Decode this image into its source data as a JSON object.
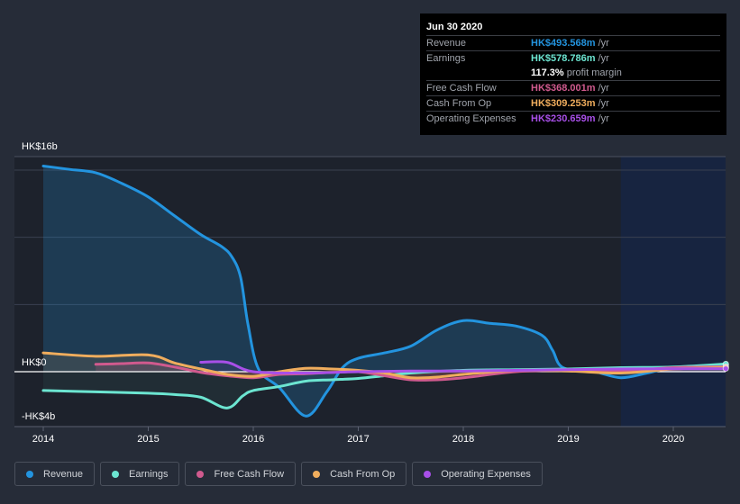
{
  "tooltip": {
    "date": "Jun 30 2020",
    "rows": [
      {
        "label": "Revenue",
        "value": "HK$493.568m",
        "unit": "/yr",
        "color": "#2394df"
      },
      {
        "label": "Earnings",
        "value": "HK$578.786m",
        "unit": "/yr",
        "color": "#6ce5d1"
      },
      {
        "label": "",
        "value": "117.3%",
        "unit": "profit margin",
        "color": "#ffffff"
      },
      {
        "label": "Free Cash Flow",
        "value": "HK$368.001m",
        "unit": "/yr",
        "color": "#d05a8e"
      },
      {
        "label": "Cash From Op",
        "value": "HK$309.253m",
        "unit": "/yr",
        "color": "#f0ad5d"
      },
      {
        "label": "Operating Expenses",
        "value": "HK$230.659m",
        "unit": "/yr",
        "color": "#a84fe8"
      }
    ]
  },
  "legend": [
    {
      "label": "Revenue",
      "color": "#2394df"
    },
    {
      "label": "Earnings",
      "color": "#6ce5d1"
    },
    {
      "label": "Free Cash Flow",
      "color": "#d05a8e"
    },
    {
      "label": "Cash From Op",
      "color": "#f0ad5d"
    },
    {
      "label": "Operating Expenses",
      "color": "#a84fe8"
    }
  ],
  "chart_data": {
    "type": "area",
    "title": "",
    "xlabel": "",
    "ylabel": "",
    "y_unit": "HK$ billions",
    "y_tick_labels": [
      {
        "value": 16,
        "label": "HK$16b"
      },
      {
        "value": 0,
        "label": "HK$0"
      },
      {
        "value": -4,
        "label": "-HK$4b"
      }
    ],
    "ylim": [
      -4,
      16
    ],
    "xlim": [
      2013.73,
      2020.5
    ],
    "x_ticks": [
      2014,
      2015,
      2016,
      2017,
      2018,
      2019,
      2020
    ],
    "x_tick_labels": [
      "2014",
      "2015",
      "2016",
      "2017",
      "2018",
      "2019",
      "2020"
    ],
    "grid": true,
    "highlight_range": [
      2019.5,
      2020.5
    ],
    "series": [
      {
        "name": "Revenue",
        "color": "#2394df",
        "x": [
          2014.0,
          2014.25,
          2014.5,
          2014.75,
          2015.0,
          2015.25,
          2015.5,
          2015.7,
          2015.8,
          2015.88,
          2015.95,
          2016.05,
          2016.25,
          2016.5,
          2016.7,
          2016.85,
          2017.0,
          2017.25,
          2017.5,
          2017.75,
          2018.0,
          2018.25,
          2018.5,
          2018.75,
          2018.85,
          2018.95,
          2019.25,
          2019.5,
          2019.75,
          2020.0,
          2020.5
        ],
        "values": [
          15.3,
          15.05,
          14.8,
          14.0,
          13.0,
          11.6,
          10.2,
          9.3,
          8.5,
          7.0,
          3.5,
          0.2,
          -1.2,
          -3.3,
          -1.5,
          0.3,
          1.0,
          1.4,
          1.9,
          3.1,
          3.8,
          3.6,
          3.4,
          2.7,
          1.6,
          0.3,
          0.0,
          -0.45,
          -0.1,
          0.3,
          0.49
        ]
      },
      {
        "name": "Earnings",
        "color": "#6ce5d1",
        "x": [
          2014.0,
          2014.5,
          2015.0,
          2015.25,
          2015.5,
          2015.75,
          2015.9,
          2016.0,
          2016.25,
          2016.5,
          2016.75,
          2017.0,
          2017.25,
          2017.5,
          2018.0,
          2018.5,
          2019.0,
          2019.5,
          2020.0,
          2020.5
        ],
        "values": [
          -1.4,
          -1.5,
          -1.6,
          -1.7,
          -1.9,
          -2.7,
          -1.8,
          -1.4,
          -1.1,
          -0.7,
          -0.6,
          -0.5,
          -0.3,
          -0.1,
          0.1,
          0.15,
          0.2,
          0.3,
          0.35,
          0.58
        ]
      },
      {
        "name": "Free Cash Flow",
        "color": "#d05a8e",
        "x": [
          2014.5,
          2014.75,
          2015.0,
          2015.25,
          2015.5,
          2015.75,
          2016.0,
          2016.25,
          2016.5,
          2016.75,
          2017.0,
          2017.25,
          2017.5,
          2017.75,
          2018.0,
          2018.5,
          2019.0,
          2019.5,
          2020.0,
          2020.5
        ],
        "values": [
          0.55,
          0.6,
          0.65,
          0.35,
          -0.05,
          -0.3,
          -0.45,
          -0.2,
          -0.15,
          -0.05,
          0.0,
          -0.3,
          -0.6,
          -0.6,
          -0.45,
          0.0,
          0.1,
          0.05,
          0.3,
          0.37
        ]
      },
      {
        "name": "Cash From Op",
        "color": "#f0ad5d",
        "x": [
          2014.0,
          2014.5,
          2015.0,
          2015.25,
          2015.5,
          2015.75,
          2016.0,
          2016.25,
          2016.5,
          2016.75,
          2017.0,
          2017.25,
          2017.5,
          2017.75,
          2018.0,
          2018.5,
          2019.0,
          2019.5,
          2020.0,
          2020.5
        ],
        "values": [
          1.4,
          1.15,
          1.25,
          0.65,
          0.2,
          -0.2,
          -0.35,
          0.0,
          0.25,
          0.2,
          0.1,
          -0.1,
          -0.45,
          -0.4,
          -0.2,
          0.1,
          0.05,
          -0.1,
          0.2,
          0.31
        ]
      },
      {
        "name": "Operating Expenses",
        "color": "#a84fe8",
        "x": [
          2015.5,
          2015.75,
          2016.0,
          2016.5,
          2017.0,
          2017.5,
          2018.0,
          2018.5,
          2019.0,
          2019.5,
          2020.0,
          2020.5
        ],
        "values": [
          0.7,
          0.7,
          0.0,
          -0.1,
          0.0,
          0.05,
          0.05,
          0.1,
          0.15,
          0.2,
          0.22,
          0.23
        ]
      }
    ]
  }
}
